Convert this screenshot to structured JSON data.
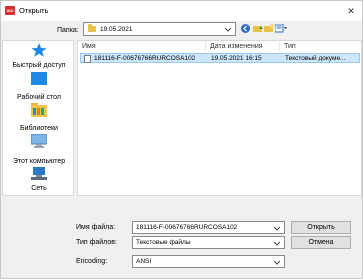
{
  "window": {
    "title": "Открыть",
    "app_icon_text": "AIO"
  },
  "toolbar": {
    "folder_label": "Папка:",
    "folder_value": "19.05.2021"
  },
  "places": [
    {
      "label": "Быстрый доступ",
      "icon": "star-icon"
    },
    {
      "label": "Рабочий стол",
      "icon": "desktop-icon"
    },
    {
      "label": "Библиотеки",
      "icon": "libraries-icon"
    },
    {
      "label": "Этот компьютер",
      "icon": "computer-icon"
    },
    {
      "label": "Сеть",
      "icon": "network-icon"
    }
  ],
  "file_list": {
    "columns": [
      "Имя",
      "Дата изменения",
      "Тип"
    ],
    "rows": [
      {
        "name": "181116-F-00676766RURCOSA102",
        "date": "19.05.2021 16:15",
        "type": "Текстовый докуме..."
      }
    ]
  },
  "form": {
    "filename_label": "Имя файла:",
    "filename_value": "181116-F-00676766RURCOSA102",
    "filetype_label": "Тип файлов:",
    "filetype_value": "Текстовые файлы",
    "encoding_label": "Encoding:",
    "encoding_value": "ANSI"
  },
  "buttons": {
    "open": "Открыть",
    "cancel": "Отмена"
  },
  "colors": {
    "selection_bg": "#cce6fb",
    "selection_border": "#99c9ef",
    "accent_blue": "#2c6fc1",
    "folder_yellow": "#e8c24a"
  }
}
